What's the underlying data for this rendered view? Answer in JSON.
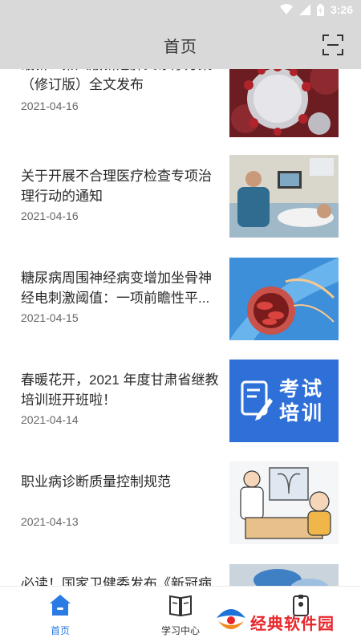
{
  "status_bar": {
    "time": "3:26",
    "icons": [
      "wifi-icon",
      "signal-icon",
      "battery-icon"
    ]
  },
  "header": {
    "title": "首页",
    "scan_icon": "scan-icon"
  },
  "news": [
    {
      "title": "最新！第八版新冠肺炎诊疗方案（修订版）全文发布",
      "date": "2021-04-16",
      "image": "coronavirus-illustration"
    },
    {
      "title": "关于开展不合理医疗检查专项治理行动的通知",
      "date": "2021-04-16",
      "image": "ultrasound-exam-photo"
    },
    {
      "title": "糖尿病周围神经病变增加坐骨神经电刺激阈值：一项前瞻性平...",
      "date": "2021-04-15",
      "image": "blood-vessel-illustration"
    },
    {
      "title": "春暖花开，2021 年度甘肃省继教培训班开班啦！",
      "date": "2021-04-14",
      "image": "exam-training-badge",
      "image_text": "考试培训"
    },
    {
      "title": "职业病诊断质量控制规范",
      "date": "2021-04-13",
      "image": "doctor-xray-cartoon"
    },
    {
      "title": "必读！国家卫健委发布《新冠病",
      "date": "",
      "image": "gloved-hands-photo"
    }
  ],
  "bottom_nav": [
    {
      "label": "首页",
      "icon": "home-icon",
      "active": true
    },
    {
      "label": "学习中心",
      "icon": "book-icon",
      "active": false
    },
    {
      "label": "",
      "icon": "id-badge-icon",
      "active": false
    }
  ],
  "watermark": {
    "text": "经典软件园"
  },
  "colors": {
    "header_bg": "#d9d9d9",
    "accent": "#2a7be4",
    "watermark": "#e8262b"
  }
}
